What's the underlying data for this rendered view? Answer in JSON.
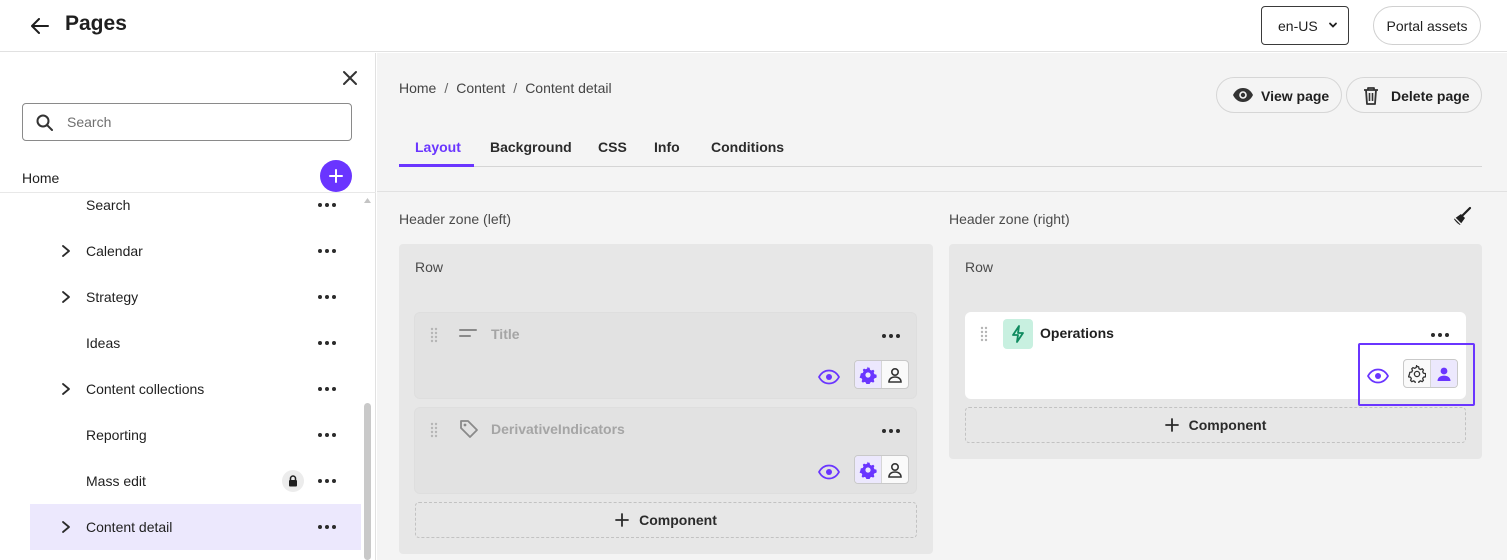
{
  "header": {
    "title": "Pages",
    "locale": "en-US",
    "portal_assets": "Portal assets"
  },
  "sidebar": {
    "search_placeholder": "Search",
    "home_label": "Home",
    "items": [
      {
        "label": "Search",
        "expandable": false
      },
      {
        "label": "Calendar",
        "expandable": true
      },
      {
        "label": "Strategy",
        "expandable": true
      },
      {
        "label": "Ideas",
        "expandable": false
      },
      {
        "label": "Content collections",
        "expandable": true
      },
      {
        "label": "Reporting",
        "expandable": false
      },
      {
        "label": "Mass edit",
        "expandable": false,
        "locked": true
      },
      {
        "label": "Content detail",
        "expandable": true,
        "selected": true
      }
    ]
  },
  "main": {
    "breadcrumb": [
      "Home",
      "Content",
      "Content detail"
    ],
    "view_page": "View page",
    "delete_page": "Delete page",
    "tabs": [
      "Layout",
      "Background",
      "CSS",
      "Info",
      "Conditions"
    ],
    "active_tab": "Layout",
    "zones": {
      "left": {
        "title": "Header zone (left)",
        "row_label": "Row",
        "components": [
          {
            "name": "Title",
            "icon": "text-lines-icon",
            "state": "disabled"
          },
          {
            "name": "DerivativeIndicators",
            "icon": "tag-icon",
            "state": "disabled"
          }
        ],
        "add_label": "Component"
      },
      "right": {
        "title": "Header zone (right)",
        "row_label": "Row",
        "components": [
          {
            "name": "Operations",
            "icon": "lightning-icon",
            "state": "enabled"
          }
        ],
        "add_label": "Component"
      }
    },
    "accent_color": "#6a35ff"
  }
}
